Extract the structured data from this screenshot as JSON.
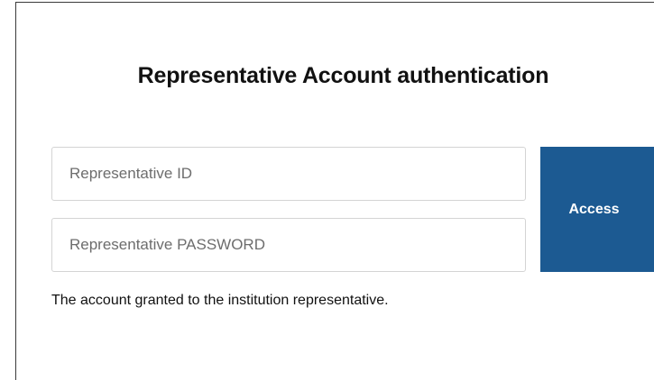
{
  "auth": {
    "title": "Representative Account authentication",
    "id_placeholder": "Representative ID",
    "password_placeholder": "Representative PASSWORD",
    "access_label": "Access",
    "note": "The account granted to the institution representative.",
    "accent_color": "#1c5a92"
  }
}
